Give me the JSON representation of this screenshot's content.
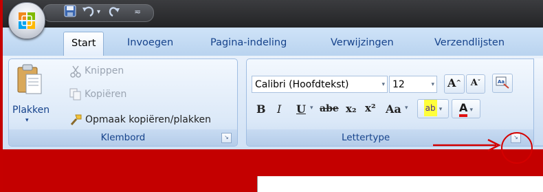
{
  "quick_access": {
    "save_icon": "save-icon",
    "undo_icon": "undo-icon",
    "redo_icon": "redo-icon",
    "customize_icon": "customize-qat-icon"
  },
  "tabs": [
    "Start",
    "Invoegen",
    "Pagina-indeling",
    "Verwijzingen",
    "Verzendlijsten"
  ],
  "clipboard": {
    "paste_label": "Plakken",
    "cut_label": "Knippen",
    "copy_label": "Kopiëren",
    "format_painter_label": "Opmaak kopiëren/plakken",
    "group_label": "Klembord"
  },
  "font": {
    "font_name": "Calibri (Hoofdtekst)",
    "font_size": "12",
    "bold": "B",
    "italic": "I",
    "underline": "U",
    "strikethrough": "abe",
    "subscript": "x₂",
    "superscript": "x²",
    "change_case": "Aa",
    "grow_font": "A",
    "shrink_font": "A",
    "font_color": "A",
    "group_label": "Lettertype"
  },
  "colors": {
    "annotation": "#d40000",
    "background": "#c50000",
    "ribbon": "#dce9f8",
    "tab_text": "#15428b"
  }
}
